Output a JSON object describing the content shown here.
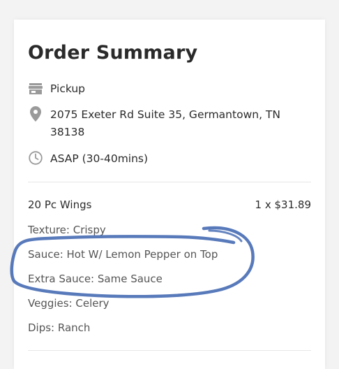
{
  "summary": {
    "title": "Order Summary"
  },
  "fulfillment": {
    "method": "Pickup",
    "method_icon": "store-icon",
    "address": "2075 Exeter Rd Suite 35, Germantown, TN 38138",
    "address_icon": "location-pin-icon",
    "time": "ASAP (30-40mins)",
    "time_icon": "clock-icon"
  },
  "item": {
    "name": "20 Pc Wings",
    "price": "1 x $31.89",
    "options": [
      "Texture: Crispy",
      "Sauce: Hot W/ Lemon Pepper on Top",
      "Extra Sauce: Same Sauce",
      "Veggies: Celery",
      "Dips: Ranch"
    ]
  },
  "colors": {
    "annotation_stroke": "#4a6fb5",
    "icon": "#9a9a9a"
  }
}
